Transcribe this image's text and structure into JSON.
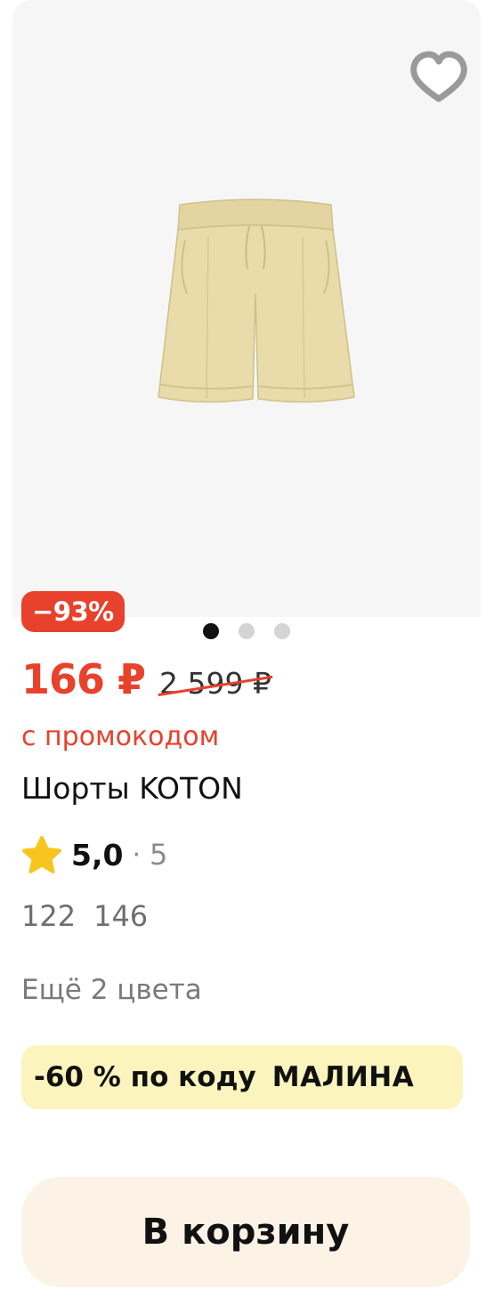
{
  "product": {
    "discount_badge": "−93%",
    "gallery_dots": {
      "count": 3,
      "active_index": 0
    },
    "price_current": "166 ₽",
    "price_old": "2 599 ₽",
    "promo_note": "с промокодом",
    "title": "Шорты KOTON",
    "rating": {
      "value": "5,0",
      "separator": "·",
      "count": "5"
    },
    "sizes": [
      "122",
      "146"
    ],
    "more_colors": "Ещё 2 цвета",
    "promo_banner": {
      "text": "-60 % по коду",
      "code": "МАЛИНА"
    },
    "cart_button_label": "В корзину"
  },
  "icons": {
    "favorite": "heart-icon",
    "rating": "star-icon"
  },
  "colors": {
    "accent_red": "#e8412c",
    "gallery_bg": "#f6f6f6",
    "promo_bg": "#fbf4bd",
    "cart_button_bg": "#fcf3e6",
    "star": "#f7c51d",
    "shorts": "#e9dcaa"
  }
}
